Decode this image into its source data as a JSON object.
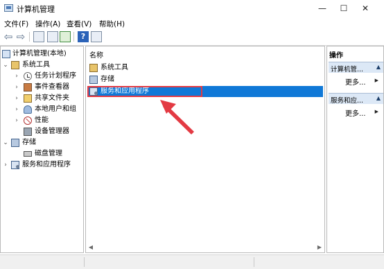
{
  "window": {
    "title": "计算机管理",
    "minimize_glyph": "—",
    "maximize_glyph": "☐",
    "close_glyph": "✕"
  },
  "menu": {
    "items": [
      "文件(F)",
      "操作(A)",
      "查看(V)",
      "帮助(H)"
    ]
  },
  "toolbar": {
    "back_glyph": "⇦",
    "forward_glyph": "⇨",
    "help_glyph": "?"
  },
  "tree": {
    "root": {
      "label": "计算机管理(本地)",
      "icon": "computer-icon"
    },
    "nodes": [
      {
        "label": "系统工具",
        "icon": "tools-icon",
        "expanded": true
      },
      {
        "label": "任务计划程序",
        "icon": "task-scheduler-icon",
        "expanded": false
      },
      {
        "label": "事件查看器",
        "icon": "event-viewer-icon",
        "expanded": false
      },
      {
        "label": "共享文件夹",
        "icon": "shared-folder-icon",
        "expanded": false
      },
      {
        "label": "本地用户和组",
        "icon": "users-icon",
        "expanded": false
      },
      {
        "label": "性能",
        "icon": "performance-icon",
        "expanded": false
      },
      {
        "label": "设备管理器",
        "icon": "device-manager-icon"
      },
      {
        "label": "存储",
        "icon": "storage-icon",
        "expanded": true
      },
      {
        "label": "磁盘管理",
        "icon": "disk-icon"
      },
      {
        "label": "服务和应用程序",
        "icon": "services-icon",
        "expanded": false
      }
    ],
    "chevron_expanded": "⌄",
    "chevron_collapsed": "›"
  },
  "center": {
    "column_header": "名称",
    "items": [
      {
        "label": "系统工具",
        "icon": "tools-icon",
        "selected": false
      },
      {
        "label": "存储",
        "icon": "storage-icon",
        "selected": false
      },
      {
        "label": "服务和应用程序",
        "icon": "services-icon",
        "selected": true
      }
    ],
    "scroll_left": "◀",
    "scroll_right": "▶"
  },
  "actions": {
    "header": "操作",
    "sections": [
      {
        "title": "计算机管...",
        "more": "更多..."
      },
      {
        "title": "服务和应...",
        "more": "更多..."
      }
    ],
    "collapse_glyph": "▲",
    "more_arrow": "▶"
  },
  "colors": {
    "selection": "#0f78d7",
    "annotation": "#e33a43",
    "section_bg": "#dce8f6"
  }
}
